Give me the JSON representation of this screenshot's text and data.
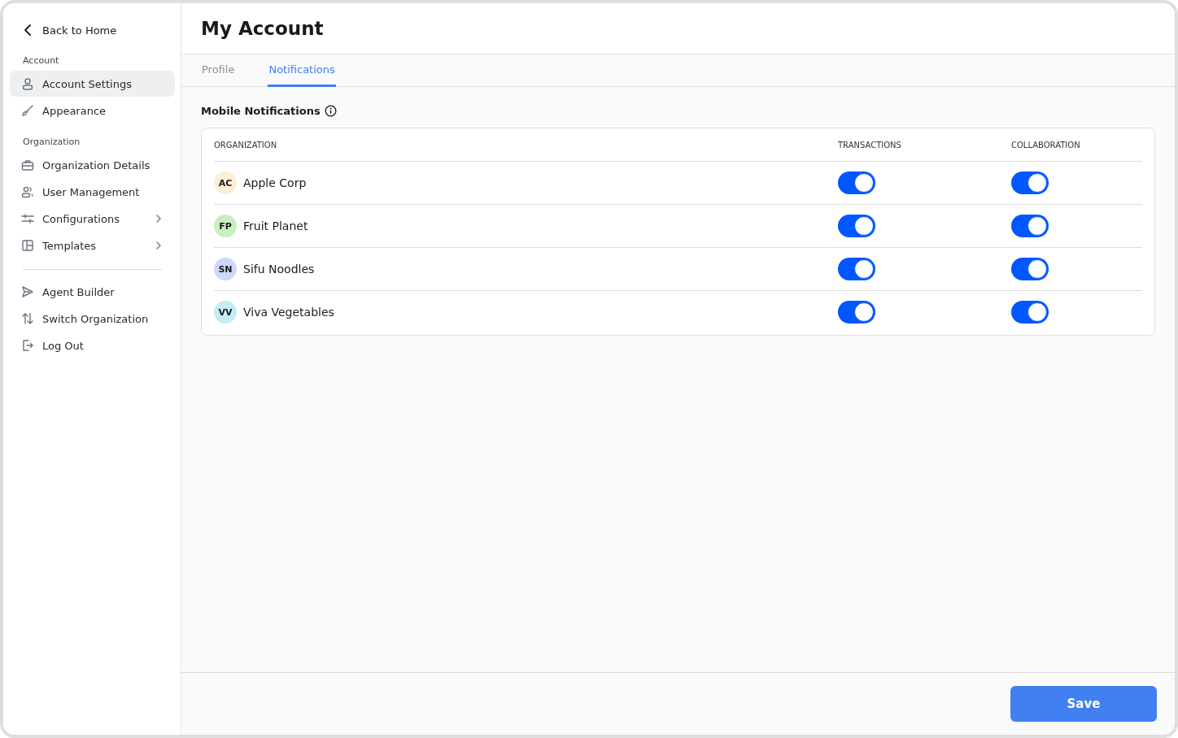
{
  "sidebar": {
    "back": {
      "label": "Back to Home"
    },
    "sections": [
      {
        "heading": "Account",
        "items": [
          {
            "label": "Account Settings",
            "selected": true,
            "expandable": false
          },
          {
            "label": "Appearance",
            "selected": false,
            "expandable": false
          }
        ]
      },
      {
        "heading": "Organization",
        "items": [
          {
            "label": "Organization Details",
            "selected": false,
            "expandable": false
          },
          {
            "label": "User Management",
            "selected": false,
            "expandable": false
          },
          {
            "label": "Configurations",
            "selected": false,
            "expandable": true
          },
          {
            "label": "Templates",
            "selected": false,
            "expandable": true
          }
        ]
      }
    ],
    "footer_items": [
      {
        "label": "Agent Builder"
      },
      {
        "label": "Switch Organization"
      },
      {
        "label": "Log Out"
      }
    ]
  },
  "page": {
    "title": "My Account"
  },
  "tabs": [
    {
      "label": "Profile",
      "selected": false
    },
    {
      "label": "Notifications",
      "selected": true
    }
  ],
  "section": {
    "title": "Mobile Notifications"
  },
  "table": {
    "columns": [
      "ORGANIZATION",
      "TRANSACTIONS",
      "COLLABORATION"
    ],
    "rows": [
      {
        "initials": "AC",
        "color": "#fdeed5",
        "name": "Apple Corp",
        "transactions": {
          "on": true
        },
        "collaboration": {
          "on": true
        }
      },
      {
        "initials": "FP",
        "color": "#c7efc0",
        "name": "Fruit Planet",
        "transactions": {
          "on": true
        },
        "collaboration": {
          "on": true
        }
      },
      {
        "initials": "SN",
        "color": "#cdd9fb",
        "name": "Sifu Noodles",
        "transactions": {
          "on": true
        },
        "collaboration": {
          "on": true
        }
      },
      {
        "initials": "VV",
        "color": "#c6ecf6",
        "name": "Viva Vegetables",
        "transactions": {
          "on": true
        },
        "collaboration": {
          "on": true
        }
      }
    ]
  },
  "footer": {
    "button": "Save"
  }
}
